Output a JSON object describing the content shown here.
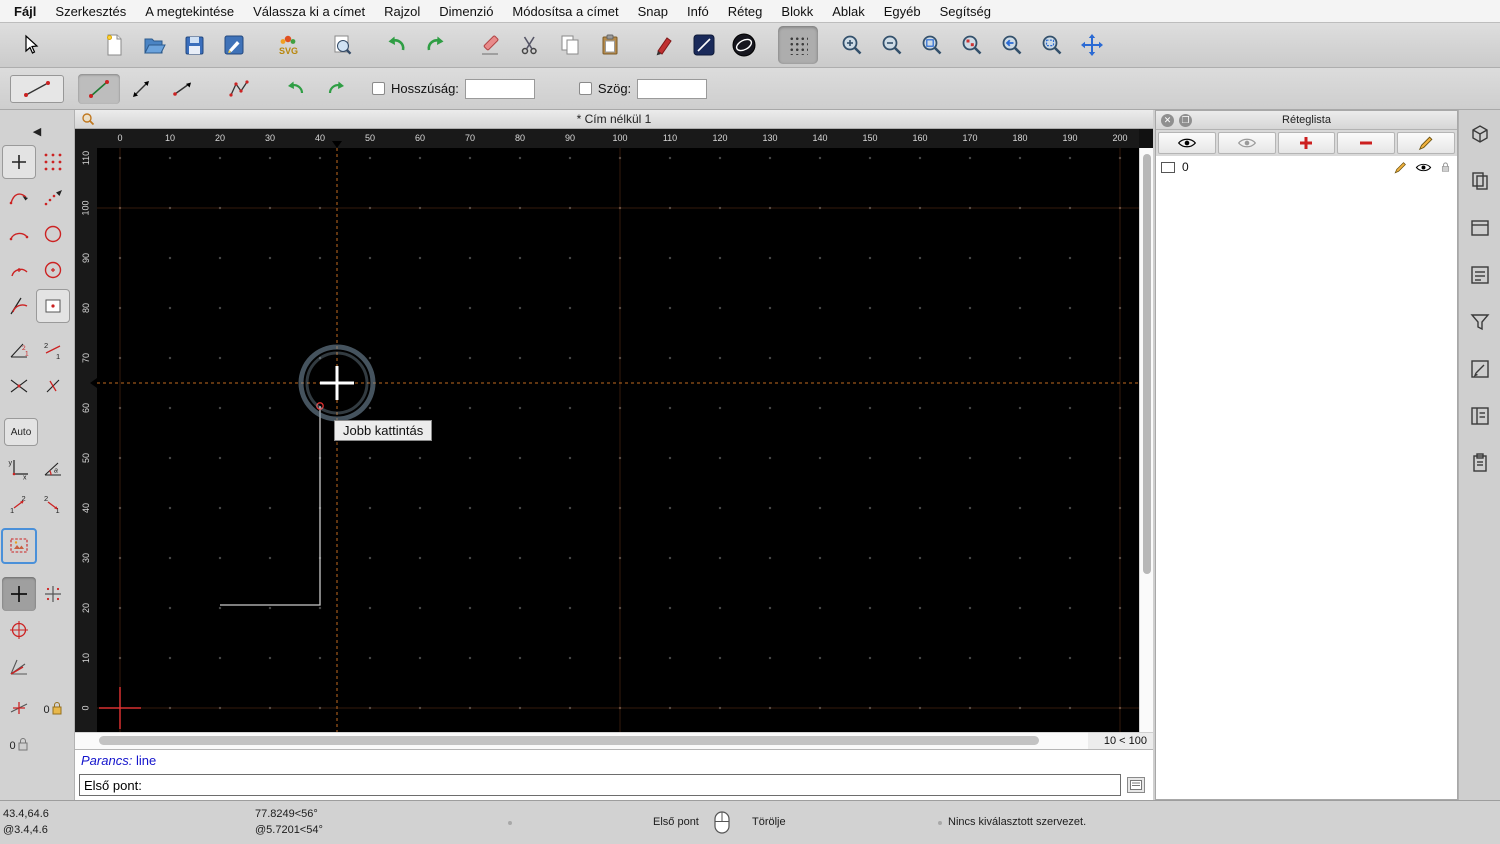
{
  "menubar": {
    "items": [
      "Fájl",
      "Szerkesztés",
      "A megtekintése",
      "Válassza ki a címet",
      "Rajzol",
      "Dimenzió",
      "Módosítsa a címet",
      "Snap",
      "Infó",
      "Réteg",
      "Blokk",
      "Ablak",
      "Egyéb",
      "Segítség"
    ]
  },
  "toolbar_main": {
    "icons": [
      "cursor-arrow",
      "new-document",
      "open-file",
      "save-file",
      "edit-drawing",
      "svg-export",
      "print-preview",
      "undo",
      "redo",
      "delete-entities",
      "cut",
      "copy",
      "paste",
      "pen-attributes",
      "line-attributes",
      "ellipse-attributes",
      "grid-toggle",
      "zoom-in",
      "zoom-out",
      "zoom-auto",
      "zoom-previous",
      "zoom-back",
      "zoom-window",
      "zoom-pan"
    ]
  },
  "toolbar_line": {
    "icons": [
      "current-tool-line",
      "line-two-points",
      "line-angle",
      "line-horizontal",
      "polyline",
      "undo-segment",
      "redo-segment"
    ],
    "length_label": "Hosszúság:",
    "length_value": "",
    "angle_label": "Szög:",
    "angle_value": ""
  },
  "sidebar": {
    "auto_label": "Auto",
    "icons": [
      "point-tool",
      "points-grid-tool",
      "spline-tool",
      "freehand-points-tool",
      "arc-tool",
      "circle-tool",
      "arc-center-tool",
      "circle-center-tool",
      "tangent-arc-tool",
      "rect-point-tool",
      "angle-lines-tool",
      "two-one-tool",
      "cross-line-tool",
      "tick-line-tool",
      "xy-ortho-tool",
      "angle-a-tool",
      "order-1-2-tool",
      "order-2-1-tool",
      "image-select-tool",
      "snap-free",
      "snap-grid",
      "snap-center",
      "snap-angle",
      "snap-entity",
      "lock-zero",
      "relative-zero"
    ]
  },
  "document": {
    "tab_title": "* Cím nélkül 1",
    "grid_status": "10 < 100"
  },
  "rulers": {
    "horizontal": [
      "0",
      "10",
      "20",
      "30",
      "40",
      "50",
      "60",
      "70",
      "80",
      "90",
      "100",
      "110",
      "120",
      "130",
      "140",
      "150",
      "160",
      "170",
      "180",
      "190",
      "200"
    ],
    "vertical": [
      "0",
      "10",
      "20",
      "30",
      "40",
      "50",
      "60",
      "70",
      "80",
      "90",
      "100",
      "110"
    ]
  },
  "canvas": {
    "tooltip": "Jobb kattintás"
  },
  "command": {
    "label": "Parancs:",
    "last_command": "line",
    "prompt": "Első pont:"
  },
  "layer_panel": {
    "title": "Réteglista",
    "toolbar_icons": [
      "show-all-layers-eye",
      "hide-all-layers-eye",
      "add-layer-plus",
      "remove-layer-minus",
      "edit-layer-pencil"
    ],
    "layers": [
      {
        "name": "0"
      }
    ]
  },
  "statusbar": {
    "abs": "43.4,64.6",
    "rel": "@3.4,4.6",
    "polar_abs": "77.8249<56°",
    "polar_rel": "@5.7201<54°",
    "left_button": "Első pont",
    "right_button": "Törölje",
    "selection": "Nincs kiválasztott szervezet."
  }
}
